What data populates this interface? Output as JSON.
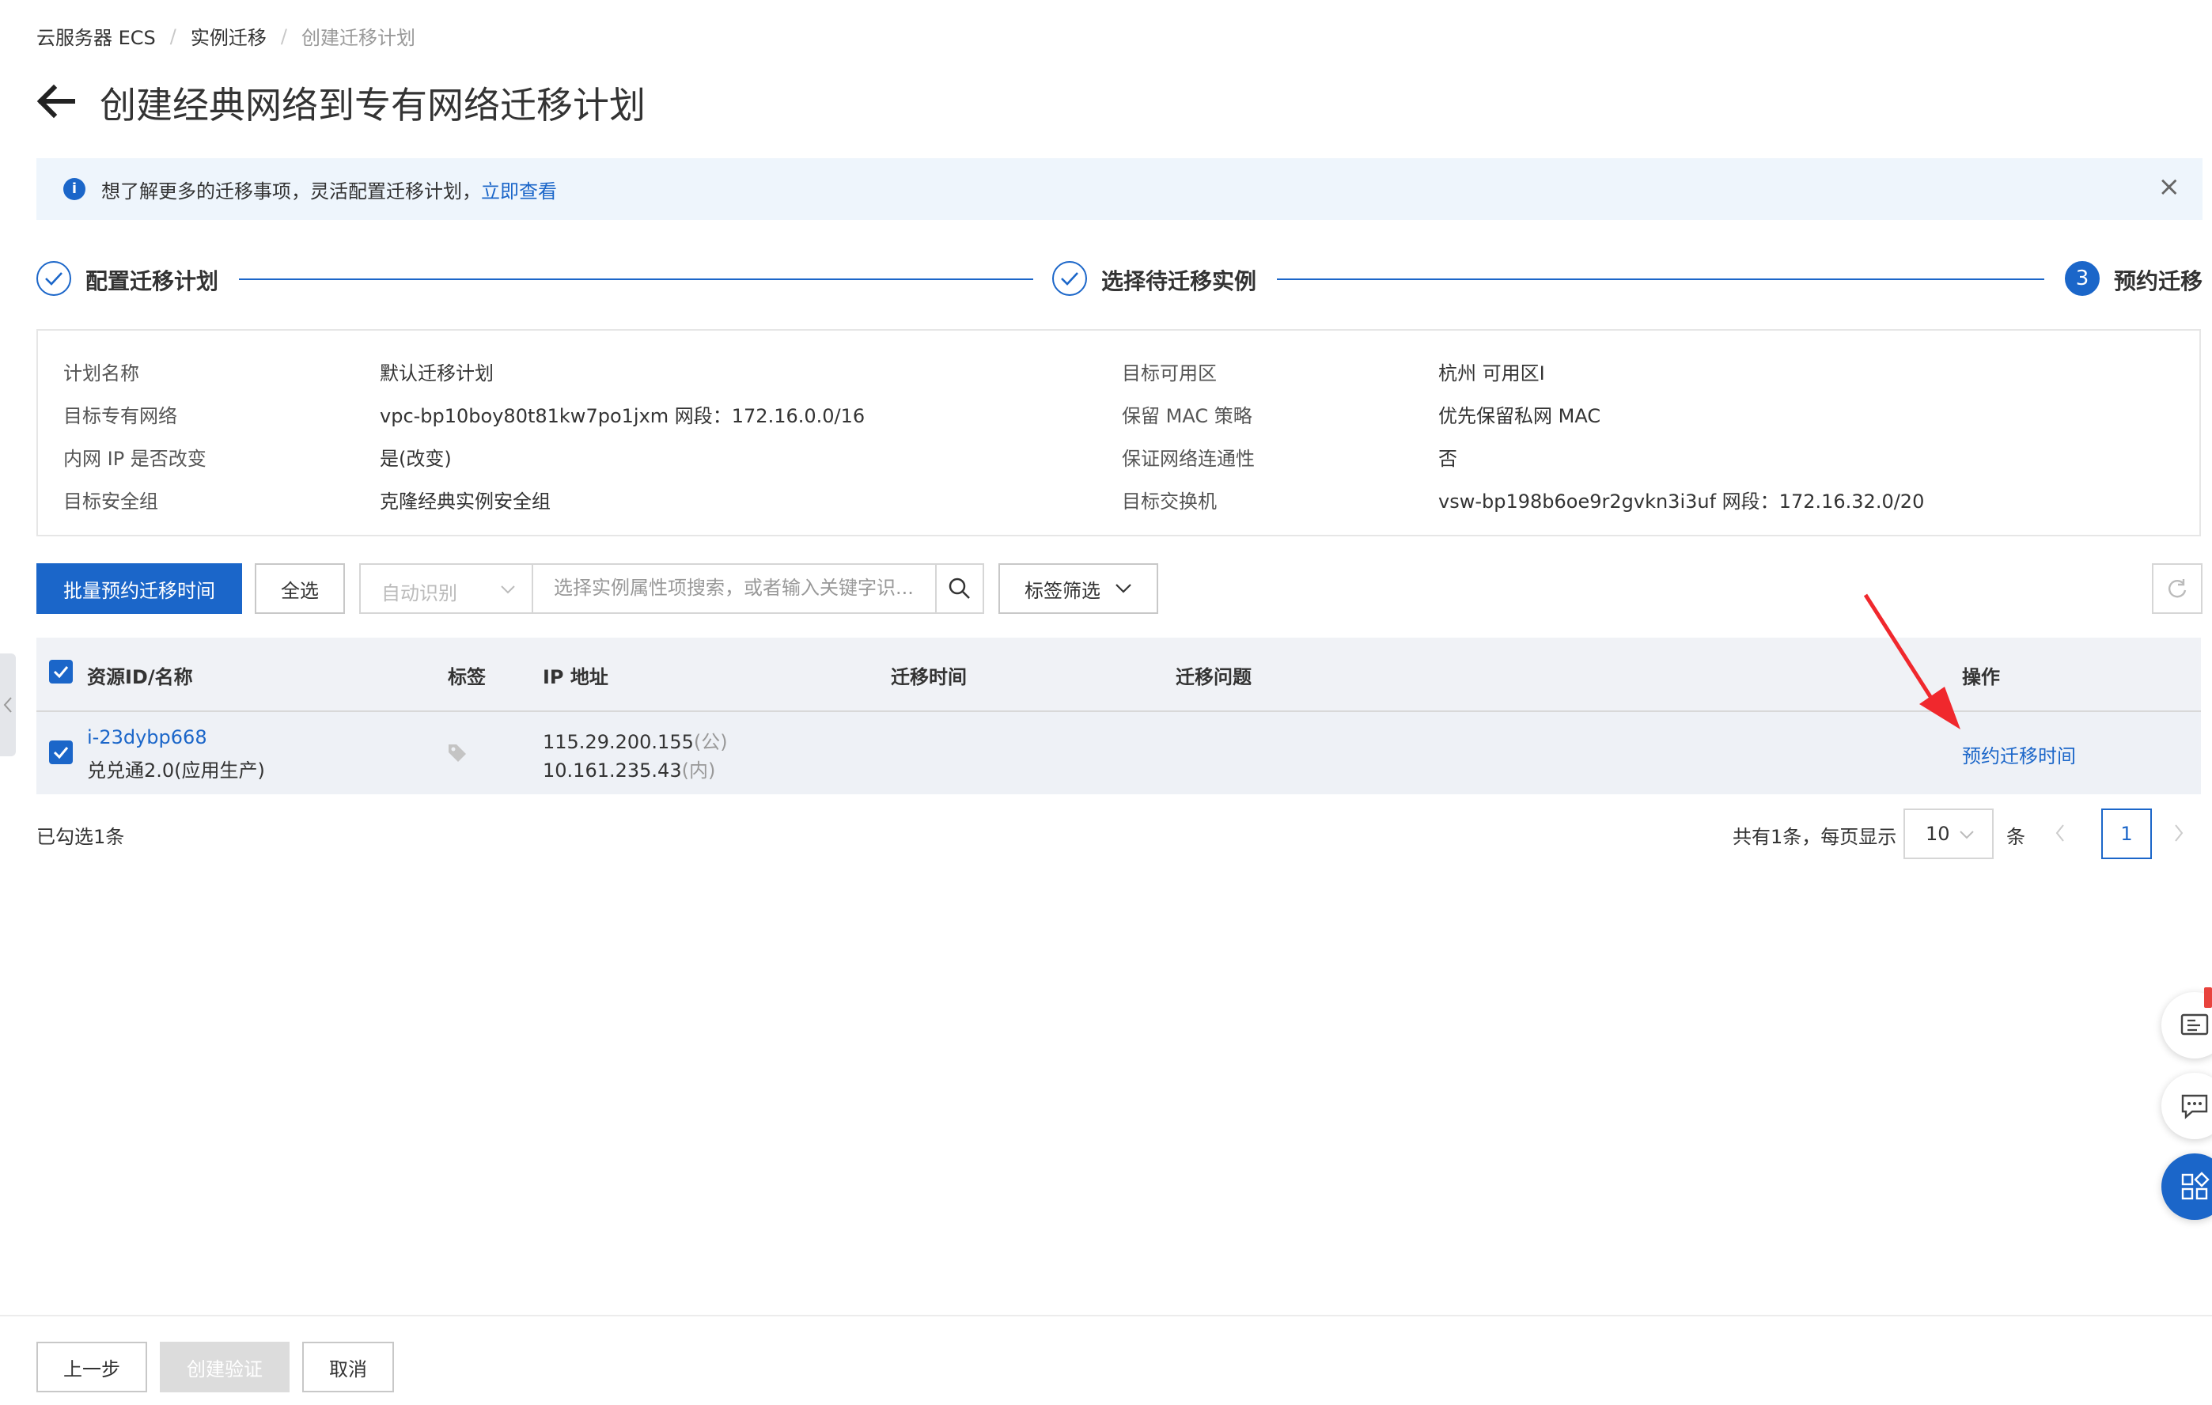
{
  "breadcrumb": {
    "items": [
      "云服务器 ECS",
      "实例迁移"
    ],
    "current": "创建迁移计划"
  },
  "page": {
    "title": "创建经典网络到专有网络迁移计划"
  },
  "notice": {
    "text": "想了解更多的迁移事项，灵活配置迁移计划，",
    "link": "立即查看",
    "icon": "info-icon",
    "close": "×"
  },
  "steps": [
    {
      "label": "配置迁移计划",
      "state": "done"
    },
    {
      "label": "选择待迁移实例",
      "state": "done"
    },
    {
      "label": "预约迁移",
      "state": "active",
      "number": "3"
    }
  ],
  "summary": {
    "left": [
      {
        "key": "计划名称",
        "value": "默认迁移计划"
      },
      {
        "key": "目标专有网络",
        "value": "vpc-bp10boy80t81kw7po1jxm 网段：172.16.0.0/16"
      },
      {
        "key": "内网 IP 是否改变",
        "value": "是(改变)"
      },
      {
        "key": "目标安全组",
        "value": "克隆经典实例安全组"
      }
    ],
    "right": [
      {
        "key": "目标可用区",
        "value": "杭州 可用区I"
      },
      {
        "key": "保留 MAC 策略",
        "value": "优先保留私网 MAC"
      },
      {
        "key": "保证网络连通性",
        "value": "否"
      },
      {
        "key": "目标交换机",
        "value": "vsw-bp198b6oe9r2gvkn3i3uf 网段：172.16.32.0/20"
      }
    ]
  },
  "toolbar": {
    "batch_label": "批量预约迁移时间",
    "select_all_label": "全选",
    "auto_detect_placeholder": "自动识别",
    "search_placeholder": "选择实例属性项搜索，或者输入关键字识...",
    "tag_filter_label": "标签筛选"
  },
  "table": {
    "columns": [
      "资源ID/名称",
      "标签",
      "IP 地址",
      "迁移时间",
      "迁移问题",
      "操作"
    ],
    "rows": [
      {
        "id": "i-23dybp668",
        "name": "兑兑通2.0(应用生产)",
        "public_ip": "115.29.200.155",
        "public_suffix": "(公)",
        "private_ip": "10.161.235.43",
        "private_suffix": "(内)",
        "migration_time": "",
        "migration_issue": "",
        "action": "预约迁移时间",
        "selected": true
      }
    ]
  },
  "selection": {
    "text": "已勾选1条"
  },
  "pagination": {
    "total_text": "共有1条，每页显示",
    "page_size": "10",
    "unit": "条",
    "current_page": "1"
  },
  "footer": {
    "prev_label": "上一步",
    "create_label": "创建验证",
    "cancel_label": "取消"
  },
  "annotation": {
    "color": "#f0282d"
  },
  "colors": {
    "primary": "#1b66c9",
    "notice_bg": "#eef5fc",
    "table_header_bg": "#f0f2f6"
  }
}
